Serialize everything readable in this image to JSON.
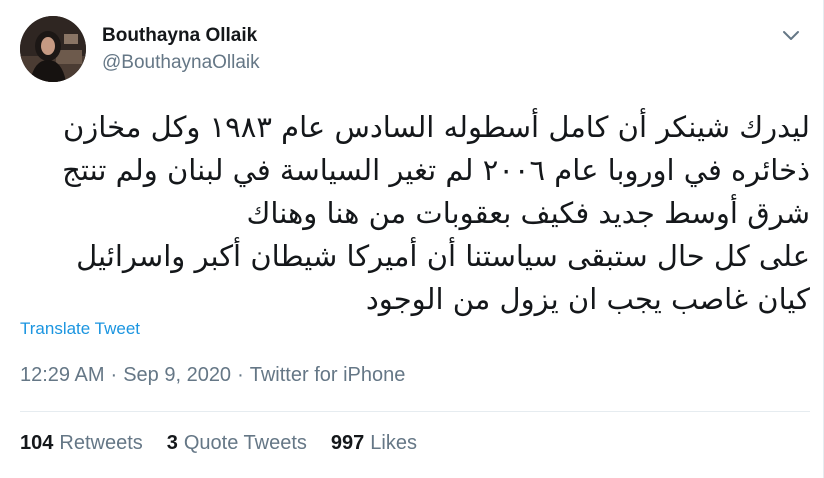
{
  "user": {
    "display_name": "Bouthayna Ollaik",
    "handle": "@BouthaynaOllaik"
  },
  "tweet": {
    "lines": [
      "ليدرك شينكر أن كامل أسطوله السادس  عام ١٩٨٣ وكل مخازن",
      "ذخائره في اوروبا عام ٢٠٠٦ لم تغير السياسة في لبنان ولم تنتج",
      "شرق أوسط جديد فكيف بعقوبات من هنا وهناك",
      "على كل حال ستبقى سياستنا أن أميركا شيطان أكبر واسرائيل",
      "كيان غاصب يجب ان يزول من الوجود"
    ],
    "translate_label": "Translate Tweet"
  },
  "meta": {
    "time": "12:29 AM",
    "date": "Sep 9, 2020",
    "source": "Twitter for iPhone",
    "separator": "·"
  },
  "stats": {
    "retweets_count": "104",
    "retweets_label": "Retweets",
    "quote_count": "3",
    "quote_label": "Quote Tweets",
    "likes_count": "997",
    "likes_label": "Likes"
  },
  "colors": {
    "link": "#1b95e0",
    "secondary_text": "#657786",
    "primary_text": "#14171a",
    "divider": "#e6ecf0"
  },
  "icons": {
    "caret": "chevron-down-icon",
    "avatar": "profile-photo"
  }
}
